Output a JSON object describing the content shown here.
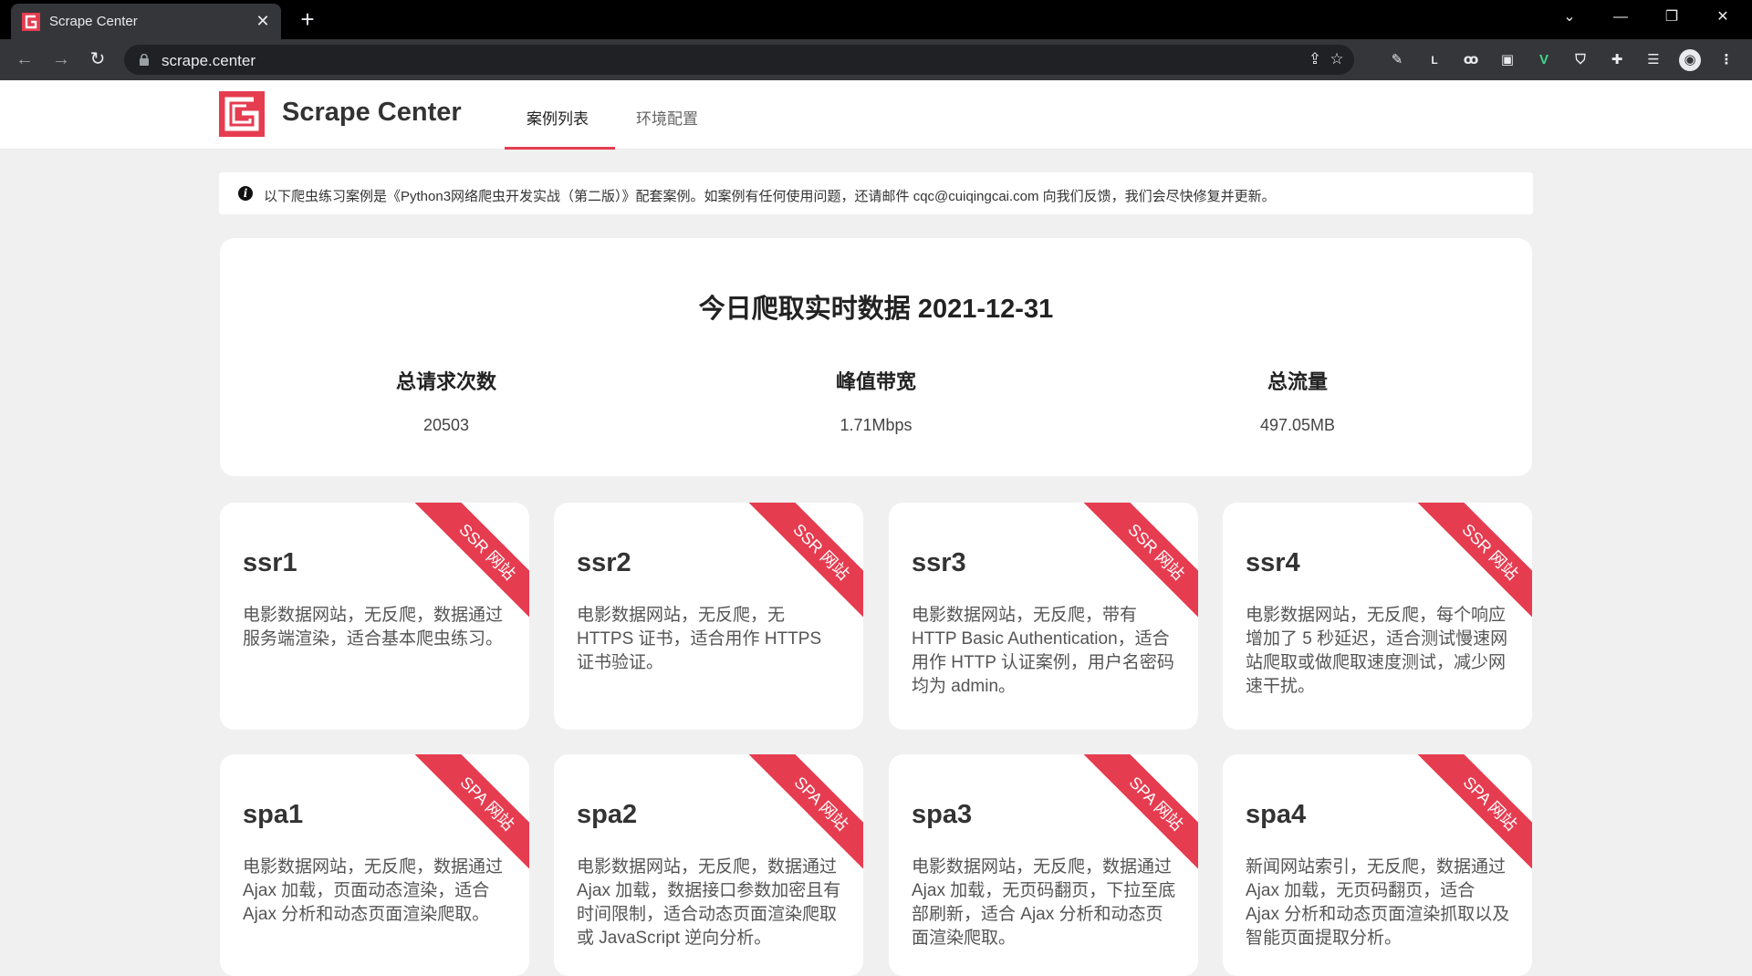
{
  "browser": {
    "tab_title": "Scrape Center",
    "tab_close": "✕",
    "new_tab": "+",
    "url": "scrape.center",
    "window_controls": {
      "tab_search": "⌄",
      "minimize": "—",
      "restore": "❐",
      "close": "✕"
    }
  },
  "header": {
    "brand": "Scrape Center",
    "nav": {
      "cases": "案例列表",
      "env": "环境配置"
    }
  },
  "notice": {
    "icon": "i",
    "text": "以下爬虫练习案例是《Python3网络爬虫开发实战（第二版）》配套案例。如案例有任何使用问题，还请邮件 cqc@cuiqingcai.com 向我们反馈，我们会尽快修复并更新。"
  },
  "stats": {
    "title": "今日爬取实时数据 2021-12-31",
    "items": [
      {
        "label": "总请求次数",
        "value": "20503"
      },
      {
        "label": "峰值带宽",
        "value": "1.71Mbps"
      },
      {
        "label": "总流量",
        "value": "497.05MB"
      }
    ]
  },
  "cards": [
    {
      "title": "ssr1",
      "badge": "SSR 网站",
      "desc": "电影数据网站，无反爬，数据通过服务端渲染，适合基本爬虫练习。"
    },
    {
      "title": "ssr2",
      "badge": "SSR 网站",
      "desc": "电影数据网站，无反爬，无 HTTPS 证书，适合用作 HTTPS 证书验证。"
    },
    {
      "title": "ssr3",
      "badge": "SSR 网站",
      "desc": "电影数据网站，无反爬，带有 HTTP Basic Authentication，适合用作 HTTP 认证案例，用户名密码均为 admin。"
    },
    {
      "title": "ssr4",
      "badge": "SSR 网站",
      "desc": "电影数据网站，无反爬，每个响应增加了 5 秒延迟，适合测试慢速网站爬取或做爬取速度测试，减少网速干扰。"
    },
    {
      "title": "spa1",
      "badge": "SPA 网站",
      "desc": "电影数据网站，无反爬，数据通过 Ajax 加载，页面动态渲染，适合 Ajax 分析和动态页面渲染爬取。"
    },
    {
      "title": "spa2",
      "badge": "SPA 网站",
      "desc": "电影数据网站，无反爬，数据通过 Ajax 加载，数据接口参数加密且有时间限制，适合动态页面渲染爬取或 JavaScript 逆向分析。"
    },
    {
      "title": "spa3",
      "badge": "SPA 网站",
      "desc": "电影数据网站，无反爬，数据通过 Ajax 加载，无页码翻页，下拉至底部刷新，适合 Ajax 分析和动态页面渲染爬取。"
    },
    {
      "title": "spa4",
      "badge": "SPA 网站",
      "desc": "新闻网站索引，无反爬，数据通过 Ajax 加载，无页码翻页，适合 Ajax 分析和动态页面渲染抓取以及智能页面提取分析。"
    }
  ],
  "colors": {
    "brand_red": "#e63c50",
    "page_bg": "#f0f0f0",
    "chrome_dark": "#35363a"
  }
}
